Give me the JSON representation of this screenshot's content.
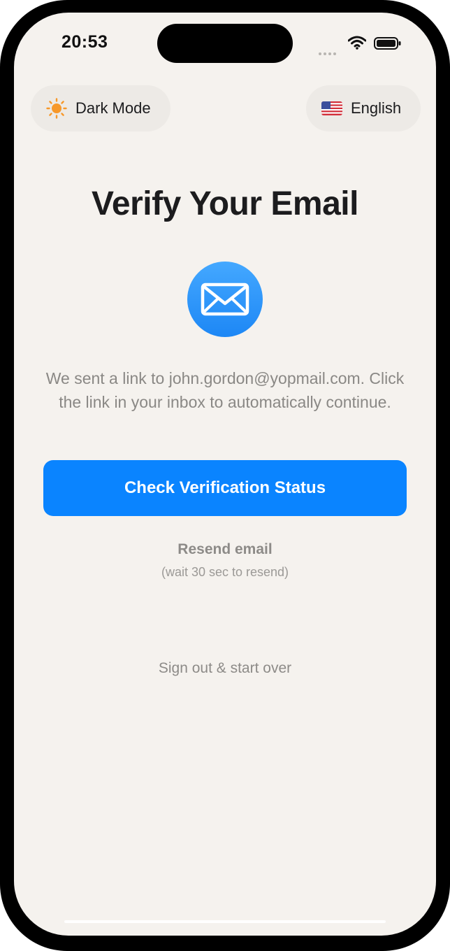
{
  "status_bar": {
    "time": "20:53"
  },
  "top_controls": {
    "theme_toggle": {
      "label": "Dark Mode",
      "icon": "sun-icon"
    },
    "language_selector": {
      "label": "English",
      "icon": "us-flag-icon"
    }
  },
  "main": {
    "title": "Verify Your Email",
    "icon": "envelope-icon",
    "message": "We sent a link to john.gordon@yopmail.com. Click the link in your inbox to automatically continue.",
    "primary_button_label": "Check Verification Status",
    "resend_label": "Resend email",
    "resend_note": "(wait 30 sec to resend)",
    "signout_label": "Sign out & start over"
  },
  "colors": {
    "accent": "#0a84ff",
    "background": "#f5f2ee",
    "pill_background": "#edeae6",
    "sun": "#f7982a"
  }
}
